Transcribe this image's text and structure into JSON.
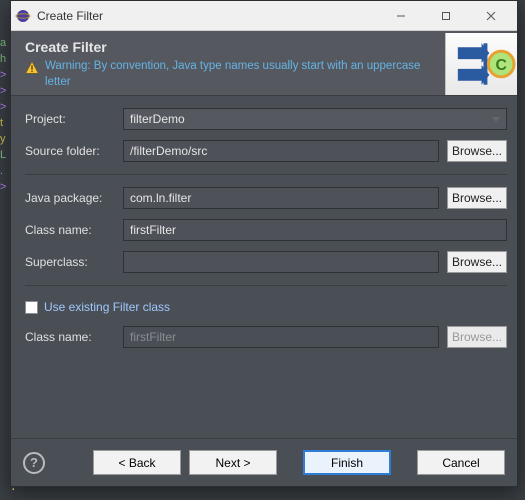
{
  "window_title": "Create Filter",
  "header": {
    "title": "Create Filter",
    "warning": "Warning: By convention, Java type names usually start with an uppercase letter"
  },
  "fields": {
    "project_label": "Project:",
    "project_value": "filterDemo",
    "source_label": "Source folder:",
    "source_value": "/filterDemo/src",
    "pkg_label": "Java package:",
    "pkg_value": "com.ln.filter",
    "class_label": "Class name:",
    "class_value": "firstFilter",
    "super_label": "Superclass:",
    "super_value": "",
    "existing_label": "Use existing Filter class",
    "class2_label": "Class name:",
    "class2_placeholder": "firstFilter"
  },
  "buttons": {
    "browse": "Browse...",
    "back": "< Back",
    "next": "Next >",
    "finish": "Finish",
    "cancel": "Cancel"
  }
}
